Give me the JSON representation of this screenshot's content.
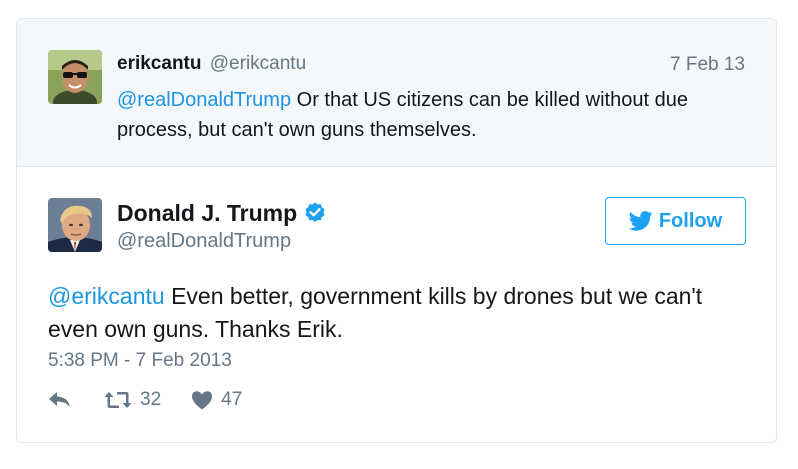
{
  "parent_tweet": {
    "display_name": "erikcantu",
    "handle": "@erikcantu",
    "date": "7 Feb 13",
    "mention": "@realDonaldTrump",
    "text": " Or that US citizens can be killed without due process, but can't own guns themselves.",
    "avatar_icon": "user-photo-sunglasses"
  },
  "main_tweet": {
    "display_name": "Donald J. Trump",
    "verified": true,
    "handle": "@realDonaldTrump",
    "follow_label": "Follow",
    "mention": "@erikcantu",
    "text": " Even better, government kills by drones but we can't even own guns. Thanks Erik.",
    "timestamp": "5:38 PM - 7 Feb 2013",
    "retweet_count": "32",
    "like_count": "47",
    "avatar_icon": "user-photo-portrait"
  },
  "colors": {
    "accent": "#1da1f2",
    "mention": "#1b95e0",
    "muted": "#657786",
    "parent_bg": "#f5f8fa",
    "border": "#e1e8ed"
  }
}
